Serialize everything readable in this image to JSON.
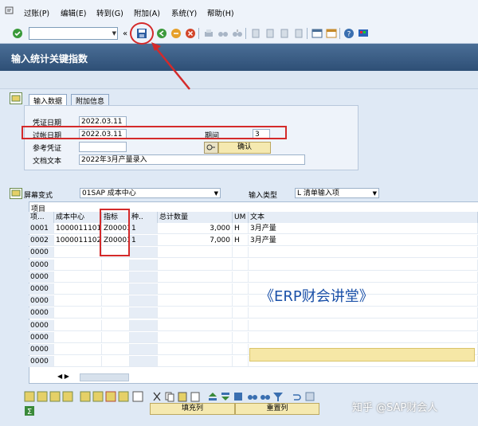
{
  "menu": {
    "items": [
      "过账(P)",
      "编辑(E)",
      "转到(G)",
      "附加(A)",
      "系统(Y)",
      "帮助(H)"
    ]
  },
  "toolbar": {
    "command_value": ""
  },
  "title": "输入统计关键指数",
  "tabs": {
    "input": "输入数据",
    "extra": "附加信息"
  },
  "form": {
    "doc_date_label": "凭证日期",
    "doc_date": "2022.03.11",
    "post_date_label": "过帐日期",
    "post_date": "2022.03.11",
    "period_label": "期间",
    "period": "3",
    "ref_label": "参考凭证",
    "ref_value": "",
    "confirm_label": "确认",
    "doc_text_label": "文档文本",
    "doc_text": "2022年3月产量录入"
  },
  "screen_variant": {
    "label": "屏幕变式",
    "value": "01SAP 成本中心"
  },
  "input_type": {
    "label": "输入类型",
    "value": "L 清单输入项"
  },
  "table": {
    "title": "项目",
    "headers": [
      "项...",
      "成本中心",
      "指标",
      "种..",
      "总计数量",
      "UM",
      "文本"
    ],
    "rows": [
      [
        "0001",
        "1000011101",
        "Z00003",
        "1",
        "3,000",
        "H",
        "3月产量"
      ],
      [
        "0002",
        "1000011102",
        "Z00003",
        "1",
        "7,000",
        "H",
        "3月产量"
      ],
      [
        "0000",
        "",
        "",
        "",
        "",
        "",
        ""
      ],
      [
        "0000",
        "",
        "",
        "",
        "",
        "",
        ""
      ],
      [
        "0000",
        "",
        "",
        "",
        "",
        "",
        ""
      ],
      [
        "0000",
        "",
        "",
        "",
        "",
        "",
        ""
      ],
      [
        "0000",
        "",
        "",
        "",
        "",
        "",
        ""
      ],
      [
        "0000",
        "",
        "",
        "",
        "",
        "",
        ""
      ],
      [
        "0000",
        "",
        "",
        "",
        "",
        "",
        ""
      ],
      [
        "0000",
        "",
        "",
        "",
        "",
        "",
        ""
      ],
      [
        "0000",
        "",
        "",
        "",
        "",
        "",
        ""
      ],
      [
        "0000",
        "",
        "",
        "",
        "",
        "",
        ""
      ]
    ]
  },
  "buttons": {
    "fill_column": "填充列",
    "reset_column": "重置列"
  },
  "watermark": "《ERP财会讲堂》",
  "zhihu": "知乎 @SAP财会人",
  "colors": {
    "highlight_red": "#d42a2a",
    "title_blue": "#2e4f76",
    "accent_yellow": "#f5e9b0"
  }
}
